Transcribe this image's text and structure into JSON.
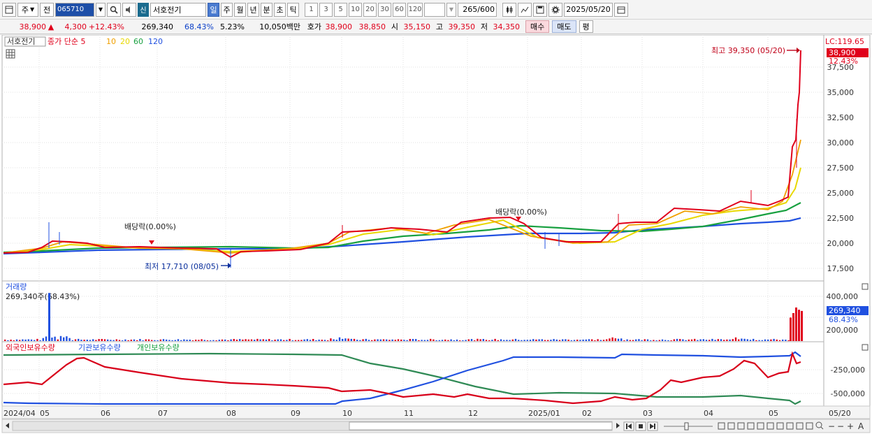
{
  "toolbar": {
    "view_type": "주",
    "prev_label": "전",
    "stock_code": "065710",
    "badge": "신",
    "stock_name": "서호전기",
    "periods": [
      "일",
      "주",
      "월",
      "년",
      "분",
      "초",
      "틱"
    ],
    "active_period": "일",
    "intervals": [
      "1",
      "3",
      "5",
      "10",
      "20",
      "30",
      "60",
      "120"
    ],
    "count": "265",
    "count_max": "/600",
    "date": "2025/05/20"
  },
  "quote": {
    "price": "38,900",
    "change_arrow": "▲",
    "change": "4,300",
    "change_pct": "+12.43%",
    "volume": "269,340",
    "vol_pct": "68.43%",
    "turnover_pct": "5.23%",
    "amount": "10,050백만",
    "bid_ask_label": "호가",
    "ask": "38,900",
    "bid": "38,850",
    "open_label": "시",
    "open": "35,150",
    "high_label": "고",
    "high": "39,350",
    "low_label": "저",
    "low": "34,350",
    "buy_label": "매수",
    "sell_label": "매도",
    "eval_label": "평"
  },
  "price_panel": {
    "stock_label": "서호전기",
    "legend": [
      {
        "label": "종가 단순 5",
        "color": "#e0001b"
      },
      {
        "label": "10",
        "color": "#f0a000"
      },
      {
        "label": "20",
        "color": "#e8d800"
      },
      {
        "label": "60",
        "color": "#18a040"
      },
      {
        "label": "120",
        "color": "#2050e0"
      }
    ],
    "lc_label": "LC:119.65",
    "current_price_tag": "38,900",
    "current_pct_tag": "12.43%",
    "high_annotation": "최고 39,350 (05/20)",
    "low_annotation": "최저 17,710 (08/05)",
    "dividend_labels": [
      "배당락(0.00%)",
      "배당락(0.00%)"
    ],
    "y_ticks": [
      "37,500",
      "35,000",
      "32,500",
      "30,000",
      "27,500",
      "25,000",
      "22,500",
      "20,000",
      "17,500"
    ]
  },
  "volume_panel": {
    "title": "거래량",
    "info": "269,340주(68.43%)",
    "y_ticks": [
      "400,000",
      "200,000"
    ],
    "current_tag": "269,340",
    "current_pct_tag": "68.43%"
  },
  "holding_panel": {
    "legend": [
      {
        "label": "외국인보유수량",
        "color": "#e0001b"
      },
      {
        "label": "기관보유수량",
        "color": "#2050e0"
      },
      {
        "label": "개인보유수량",
        "color": "#18a040"
      }
    ],
    "y_ticks": [
      "-250,000",
      "-500,000"
    ]
  },
  "x_axis": {
    "labels": [
      "2024/04",
      "05",
      "06",
      "07",
      "08",
      "09",
      "10",
      "11",
      "12",
      "2025/01",
      "02",
      "03",
      "04",
      "05"
    ],
    "right_label": "05/20"
  },
  "chart_data": {
    "type": "line",
    "price_series": {
      "ma120": [
        19100,
        19250,
        19400,
        19500,
        19550,
        19600,
        19650,
        19700,
        19750,
        19800,
        19850,
        19950,
        20150,
        20400,
        20650,
        20850,
        21000,
        21150,
        21400,
        21700,
        21950,
        22100,
        22300,
        22550
      ],
      "ma60": [
        19100,
        19300,
        19550,
        19650,
        19700,
        19700,
        19600,
        19550,
        19500,
        19550,
        19700,
        20200,
        20900,
        21400,
        21800,
        22000,
        21800,
        21500,
        21350,
        21350,
        21500,
        21900,
        22600,
        23300,
        24000
      ],
      "close": [
        19000,
        19300,
        20500,
        20300,
        19800,
        19600,
        19900,
        19500,
        17710,
        19600,
        19500,
        20800,
        21200,
        21600,
        21200,
        22500,
        22900,
        22700,
        21100,
        20200,
        20300,
        22400,
        22300,
        23500,
        24300,
        23000,
        38900
      ]
    },
    "volume_peak": 430000,
    "volume_last": 269340
  }
}
